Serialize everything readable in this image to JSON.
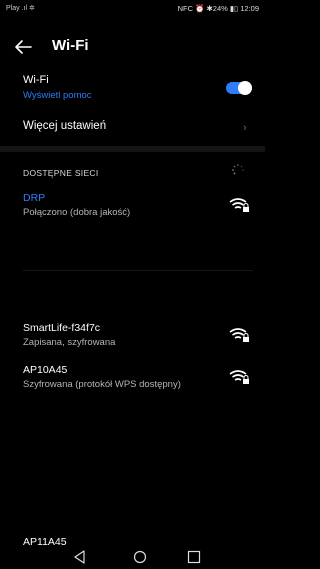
{
  "status_bar": {
    "left": "Play .ıl ✲",
    "right": "NFC ⏰ ✱24% ▮▯ 12:09"
  },
  "header": {
    "title": "Wi-Fi"
  },
  "wifi": {
    "label": "Wi-Fi",
    "help": "Wyświetl pomoc",
    "enabled": true
  },
  "more": {
    "label": "Więcej ustawień"
  },
  "section": {
    "title": "DOSTĘPNE SIECI"
  },
  "networks": [
    {
      "name": "DRP",
      "status": "Połączono (dobra jakość)",
      "connected": true
    },
    {
      "name": "SmartLife-f34f7c",
      "status": "Zapisana, szyfrowana",
      "connected": false
    },
    {
      "name": "AP10A45",
      "status": "Szyfrowana (protokół WPS dostępny)",
      "connected": false
    },
    {
      "name": "AP11A45",
      "status": "",
      "connected": false
    }
  ],
  "colors": {
    "accent": "#2f7cf7",
    "background": "#000000"
  },
  "icons": [
    "back-arrow-icon",
    "chevron-right-icon",
    "wifi-lock-icon",
    "spinner-icon",
    "nav-back-icon",
    "nav-home-icon",
    "nav-recents-icon"
  ]
}
